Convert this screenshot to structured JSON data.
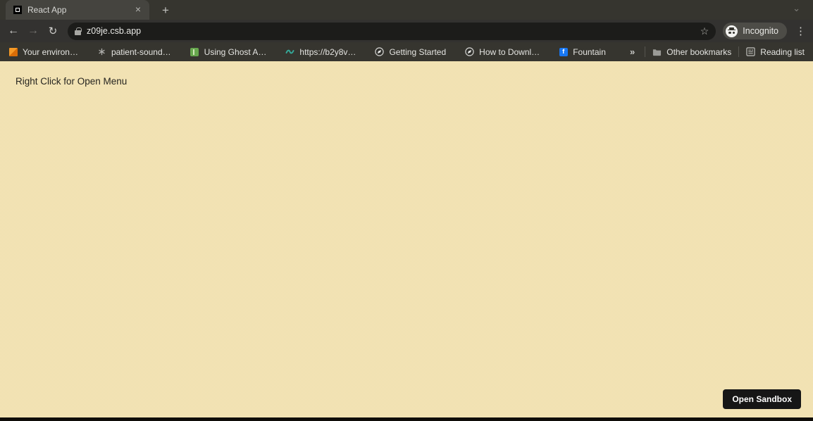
{
  "browser": {
    "tab": {
      "title": "React App"
    },
    "icons": {
      "close": "×",
      "new_tab": "+",
      "back": "←",
      "forward": "→",
      "reload": "↻",
      "star": "☆",
      "kebab": "⋮",
      "chevron_down": "⌄",
      "overflow": "»",
      "fountain_f": "f"
    },
    "omnibox": {
      "url": "z09je.csb.app"
    },
    "incognito": {
      "label": "Incognito"
    },
    "bookmarks": {
      "items": [
        {
          "label": "Your environ…",
          "icon": "cube-icon"
        },
        {
          "label": "patient-sound…",
          "icon": "asterisk-icon"
        },
        {
          "label": "Using Ghost A…",
          "icon": "green-square-icon"
        },
        {
          "label": "https://b2y8v…",
          "icon": "wave-icon"
        },
        {
          "label": "Getting Started",
          "icon": "globe-icon"
        },
        {
          "label": "How to Downl…",
          "icon": "globe-icon"
        },
        {
          "label": "Fountain",
          "icon": "facebook-f-icon"
        }
      ],
      "other_bookmarks": "Other bookmarks",
      "reading_list": "Reading list"
    }
  },
  "page": {
    "message": "Right Click for Open Menu",
    "open_sandbox": "Open Sandbox"
  },
  "colors": {
    "content_bg": "#f2e3b4",
    "chrome_bg": "#36352f",
    "toolbar_bg": "#333230",
    "omnibox_bg": "#1c1c1a",
    "active_tab_bg": "#45443f",
    "button_bg": "#161616",
    "facebook_blue": "#1877f2",
    "cube_orange": "#f69a26",
    "ghost_green": "#67a74e",
    "wave_teal": "#35a898"
  }
}
